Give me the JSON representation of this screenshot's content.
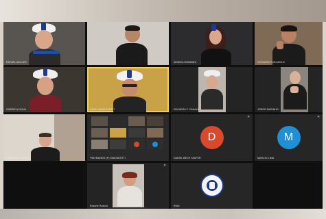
{
  "participants": [
    {
      "name": "RAFAEL MULLER",
      "muted": false
    },
    {
      "name": "",
      "muted": false
    },
    {
      "name": "MONICA DOMINGO",
      "muted": false
    },
    {
      "name": "GIOVANNI PUGLIZOLO",
      "muted": false
    },
    {
      "name": "GABRIELA SILVA",
      "muted": true
    },
    {
      "name": "FABIO MENEGHETTI",
      "muted": false
    },
    {
      "name": "EDUARDA F. CANALE",
      "muted": false
    },
    {
      "name": "JORGE MARINHO",
      "muted": false
    },
    {
      "name": "SANTIAGO JUNIOR",
      "muted": false
    },
    {
      "name": "*RAYMUNDO (P) SIMONESTTI",
      "muted": false
    },
    {
      "name": "DANIEL BECH TAUFER",
      "muted": true,
      "initial": "D",
      "color": "#d84a2b"
    },
    {
      "name": "MARCIO LIMA",
      "muted": true,
      "initial": "M",
      "color": "#1f8fd6"
    },
    {
      "name": "Rosane Rostolo",
      "muted": true
    },
    {
      "name": "Reidi",
      "muted": false
    }
  ]
}
